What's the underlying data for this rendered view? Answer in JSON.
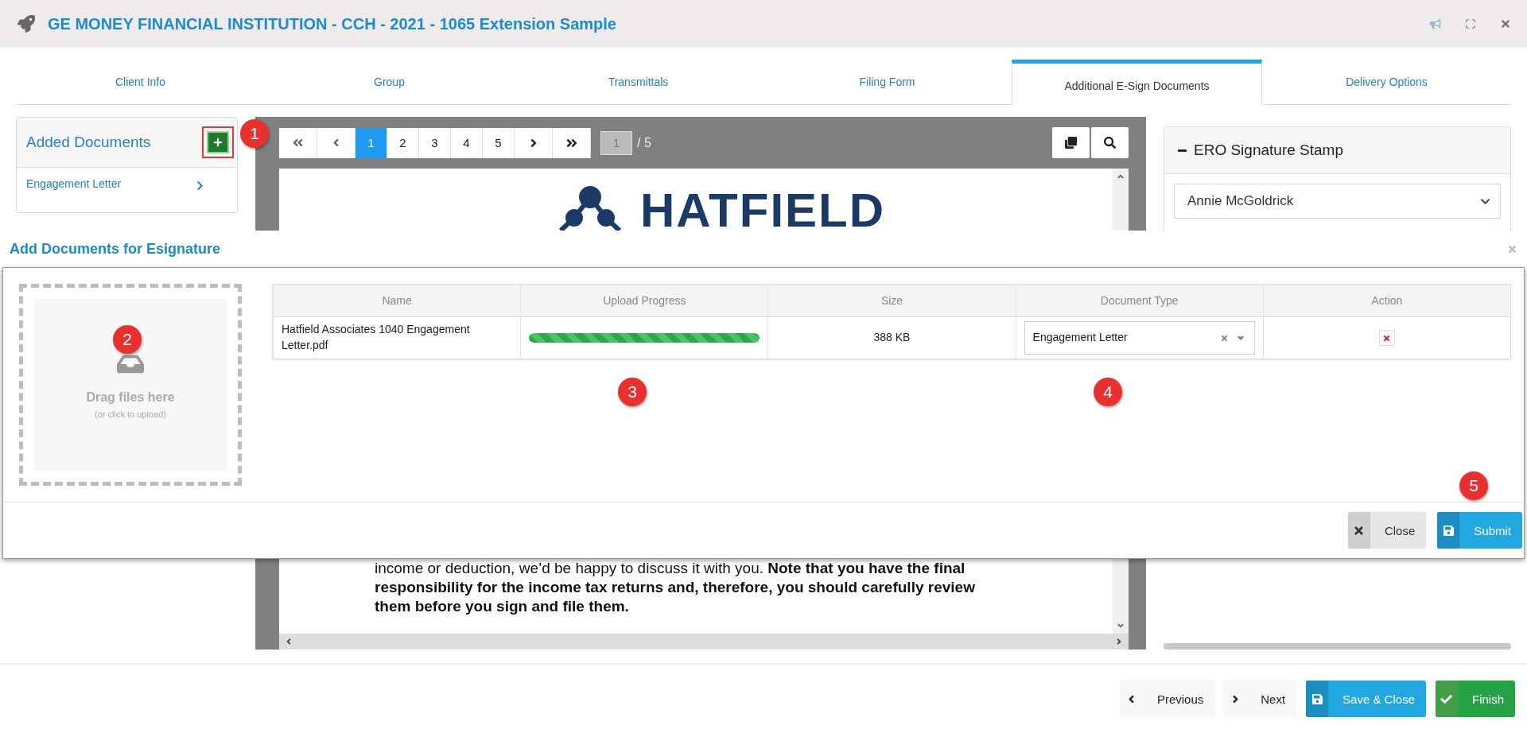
{
  "header": {
    "title": "GE MONEY FINANCIAL INSTITUTION - CCH - 2021 - 1065 Extension Sample"
  },
  "tabs": [
    {
      "label": "Client Info",
      "selected": false
    },
    {
      "label": "Group",
      "selected": false
    },
    {
      "label": "Transmittals",
      "selected": false
    },
    {
      "label": "Filing Form",
      "selected": false
    },
    {
      "label": "Additional E-Sign Documents",
      "selected": true
    },
    {
      "label": "Delivery Options",
      "selected": false
    }
  ],
  "added_documents": {
    "title": "Added Documents",
    "items": [
      {
        "label": "Engagement Letter"
      }
    ]
  },
  "viewer": {
    "pages": [
      {
        "label": "1",
        "selected": true
      },
      {
        "label": "2",
        "selected": false
      },
      {
        "label": "3",
        "selected": false
      },
      {
        "label": "4",
        "selected": false
      },
      {
        "label": "5",
        "selected": false
      }
    ],
    "page_input": "1",
    "page_total": "/ 5",
    "logo_text": "HATFIELD",
    "paragraph": "income or deduction, we’d be happy to discuss it with you. **Note that you have the final responsibility for the income tax returns and, therefore, you should carefully review them before you sign and file them.**"
  },
  "signature_stamp": {
    "title": "ERO Signature Stamp",
    "expanded": true,
    "value": "Annie McGoldrick"
  },
  "modal": {
    "title": "Add Documents for Esignature",
    "dropzone": {
      "title": "Drag files here",
      "hint": "(or click to upload)"
    },
    "table": {
      "columns": [
        "Name",
        "Upload Progress",
        "Size",
        "Document Type",
        "Action"
      ],
      "rows": [
        {
          "name": "Hatfield Associates 1040 Engagement Letter.pdf",
          "level": 1,
          "size": "388 KB",
          "document_type": "Engagement Letter"
        }
      ]
    },
    "buttons": [
      {
        "label": "Close",
        "kind": "close"
      },
      {
        "label": "Submit",
        "kind": "submit"
      }
    ]
  },
  "footer_buttons": [
    {
      "label": "Previous",
      "kind": "previous"
    },
    {
      "label": "Next",
      "kind": "next"
    },
    {
      "label": "Save & Close",
      "kind": "save"
    },
    {
      "label": "Finish",
      "kind": "finish"
    }
  ],
  "annotations": [
    "1",
    "2",
    "3",
    "4",
    "5"
  ]
}
